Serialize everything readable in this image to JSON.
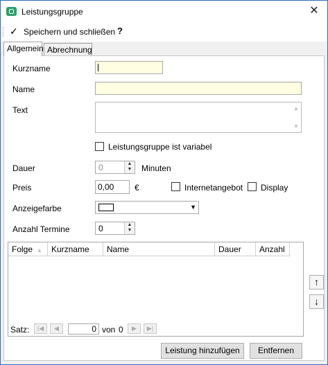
{
  "window": {
    "title": "Leistungsgruppe",
    "close_glyph": "✕"
  },
  "toolbar": {
    "save_label": "Speichern und schließen",
    "help_label": "?"
  },
  "tabs": [
    {
      "label": "Allgemein",
      "active": true
    },
    {
      "label": "Abrechnung",
      "active": false
    }
  ],
  "form": {
    "kurzname_label": "Kurzname",
    "kurzname_value": "",
    "name_label": "Name",
    "name_value": "",
    "text_label": "Text",
    "text_value": "",
    "variabel_label": "Leistungsgruppe ist variabel",
    "variabel_checked": false,
    "dauer_label": "Dauer",
    "dauer_value": "0",
    "dauer_unit": "Minuten",
    "preis_label": "Preis",
    "preis_value": "0,00",
    "preis_currency": "€",
    "internet_label": "Internetangebot",
    "internet_checked": false,
    "display_label": "Display",
    "display_checked": false,
    "anzeigefarbe_label": "Anzeigefarbe",
    "anzeigefarbe_color": "#ffffff",
    "anzahl_label": "Anzahl Termine",
    "anzahl_value": "0"
  },
  "grid": {
    "columns": [
      "Folge",
      "Kurzname",
      "Name",
      "Dauer",
      "Anzahl"
    ],
    "rows": [],
    "nav": {
      "satz_label": "Satz:",
      "position": "0",
      "von_label": "von",
      "total": "0"
    }
  },
  "buttons": {
    "add_label": "Leistung hinzufügen",
    "remove_label": "Entfernen",
    "up_glyph": "↑",
    "down_glyph": "↓"
  }
}
